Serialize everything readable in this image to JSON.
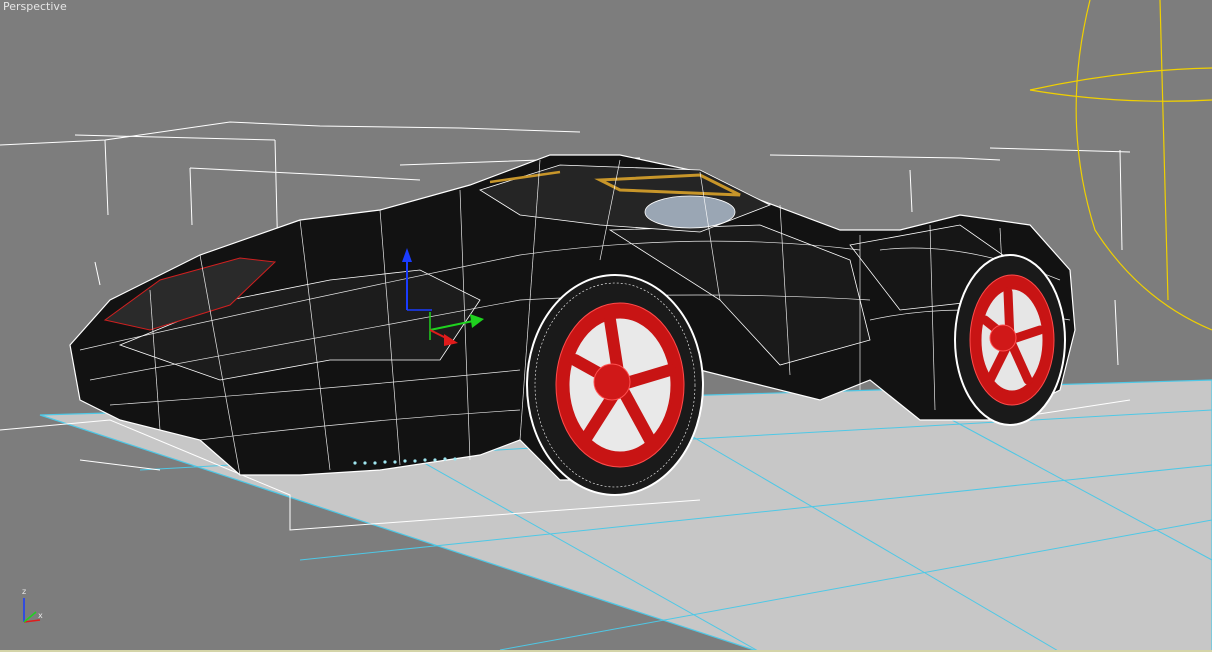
{
  "viewport": {
    "label": "Perspective",
    "axis_labels": {
      "z": "z",
      "x": "x"
    }
  },
  "colors": {
    "background": "#7d7d7d",
    "ground": "#c6c6c6",
    "grid": "#4ec8e6",
    "wire": "#ffffff",
    "rim": "#d01818",
    "light": "#f0d000",
    "gizmo_z": "#1a3cff",
    "gizmo_y": "#1fd21f",
    "gizmo_x": "#e01b1b"
  }
}
